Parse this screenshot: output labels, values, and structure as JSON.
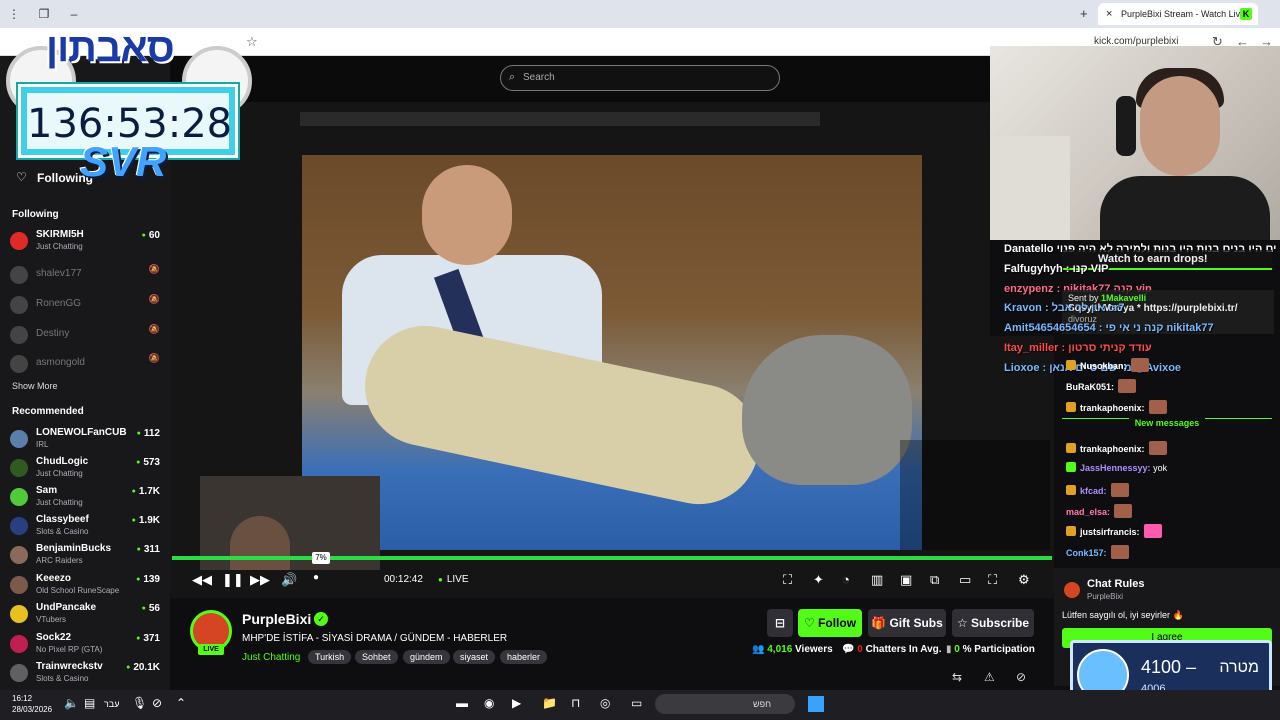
{
  "browser": {
    "tab_title": "PurpleBixi Stream - Watch Live",
    "tab_fav": "K",
    "url": "kick.com/purplebixi",
    "new_tab": "+",
    "close": "×"
  },
  "overlay": {
    "banner": "סאבתון",
    "timer": "136:53:28",
    "svr": "SVR"
  },
  "search": {
    "placeholder": "Search"
  },
  "sidebar": {
    "following_top": "Following",
    "following_head": "Following",
    "recommended_head": "Recommended",
    "show_more": "Show More",
    "following": [
      {
        "name": "SKIRMI5H",
        "category": "Just Chatting",
        "viewers": "60",
        "live": true
      },
      {
        "name": "shalev177",
        "category": "",
        "viewers": "",
        "live": false
      },
      {
        "name": "RonenGG",
        "category": "",
        "viewers": "",
        "live": false
      },
      {
        "name": "Destiny",
        "category": "",
        "viewers": "",
        "live": false
      },
      {
        "name": "asmongold",
        "category": "",
        "viewers": "",
        "live": false
      }
    ],
    "recommended": [
      {
        "name": "LONEWOLFanCUB",
        "category": "IRL",
        "viewers": "112"
      },
      {
        "name": "ChudLogic",
        "category": "Just Chatting",
        "viewers": "573"
      },
      {
        "name": "Sam",
        "category": "Just Chatting",
        "viewers": "1.7K"
      },
      {
        "name": "Classybeef",
        "category": "Slots & Casino",
        "viewers": "1.9K"
      },
      {
        "name": "BenjaminBucks",
        "category": "ARC Raiders",
        "viewers": "311"
      },
      {
        "name": "Keeezo",
        "category": "Old School RuneScape",
        "viewers": "139"
      },
      {
        "name": "UndPancake",
        "category": "VTubers",
        "viewers": "56"
      },
      {
        "name": "Sock22",
        "category": "No Pixel RP (GTA)",
        "viewers": "371"
      },
      {
        "name": "Trainwreckstv",
        "category": "Slots & Casino",
        "viewers": "20.1K"
      }
    ]
  },
  "player": {
    "volume_tip": "7%",
    "time": "00:12:42",
    "live_label": "LIVE",
    "progress": 1.0
  },
  "chat_overlay": [
    "Danatello ים היו בנים בנות היו בנות ולמירה לא היה פנוי",
    "Falfugyhyh : קנו VIP",
    "enzypenz : nikitak77 קנה vip",
    "Kravon : אין לך אבל cr7",
    "Amit54654654654 : קנה ני אי פי nikitak77",
    "Itay_miller : עודד קניתי סרטון",
    "Lioxoe : מי שם סיים אנאן @Avixoe"
  ],
  "drops": {
    "text": "Watch to earn drops!"
  },
  "pinned": {
    "sent_by": "Sent by",
    "sender": "1Makavelli",
    "message": "Sosyal Medya * https://purplebixi.tr/",
    "extra": "divoruz"
  },
  "chat": {
    "new_messages": "New messages",
    "messages": [
      {
        "user": "Nusokhan:",
        "text": "",
        "color": "#ffffff"
      },
      {
        "user": "BuRaK051:",
        "text": "",
        "color": "#ffffff"
      },
      {
        "user": "trankaphoenix:",
        "text": "",
        "color": "#ffffff"
      },
      {
        "user": "trankaphoenix:",
        "text": "",
        "color": "#ffffff"
      },
      {
        "user": "JassHennessyy:",
        "text": "yok",
        "color": "#b08cff"
      },
      {
        "user": "kfcad:",
        "text": "",
        "color": "#b08cff"
      },
      {
        "user": "mad_elsa:",
        "text": "",
        "color": "#ff7ab2"
      },
      {
        "user": "justsirfrancis:",
        "text": "",
        "color": "#ffffff"
      },
      {
        "user": "Conk157:",
        "text": "",
        "color": "#7ab8ff"
      }
    ]
  },
  "rules": {
    "title": "Chat Rules",
    "sub": "PurpleBixi",
    "text": "Lütfen saygılı ol, iyi seyirler 🔥",
    "agree": "I agree"
  },
  "goal": {
    "amount": "4100",
    "dash": "–",
    "label": "מטרה",
    "current": "4006"
  },
  "streamer": {
    "name": "PurpleBixi",
    "live": "LIVE",
    "title": "MHP'DE İSTİFA - SİYASİ DRAMA / GÜNDEM - HABERLER",
    "category": "Just Chatting",
    "tags": [
      "Turkish",
      "Sohbet",
      "gündem",
      "siyaset",
      "haberler"
    ],
    "follow": "Follow",
    "gift": "Gift Subs",
    "subscribe": "Subscribe",
    "viewers": "4,016",
    "viewers_label": "Viewers",
    "chatters": "0",
    "chatters_label": "Chatters In Avg.",
    "participation": "0",
    "participation_label": "% Participation"
  },
  "taskbar": {
    "time": "16:12",
    "date": "28/03/2026",
    "lang": "עבר",
    "search": "חפש"
  }
}
